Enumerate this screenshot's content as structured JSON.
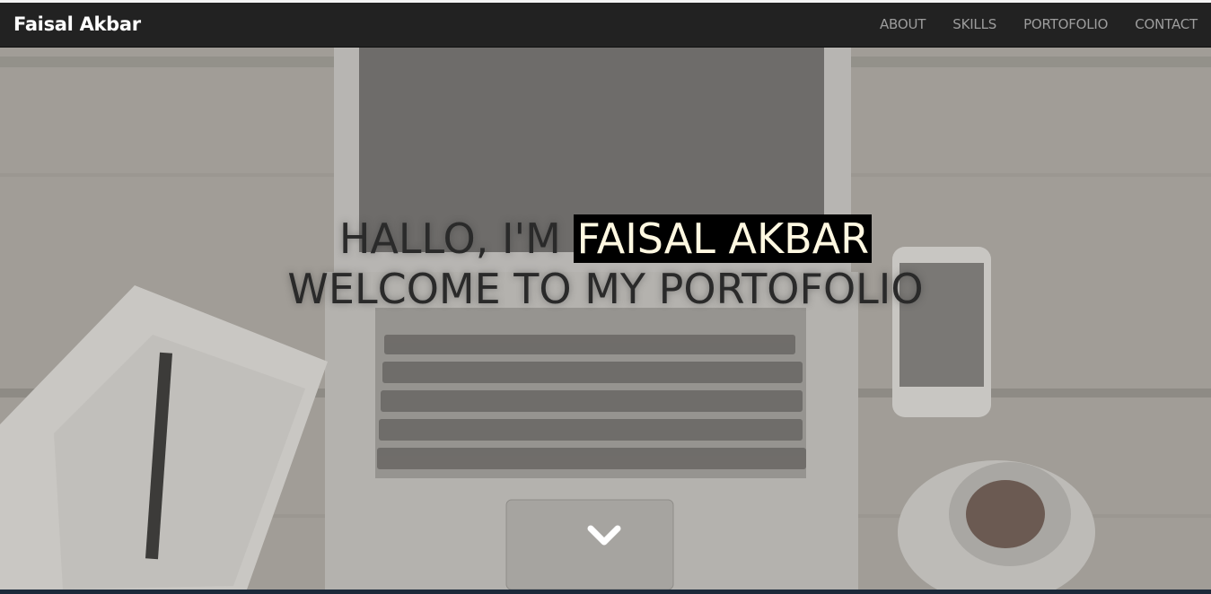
{
  "navbar": {
    "brand": "Faisal Akbar",
    "links": [
      {
        "label": "ABOUT"
      },
      {
        "label": "SKILLS"
      },
      {
        "label": "PORTOFOLIO"
      },
      {
        "label": "CONTACT"
      }
    ]
  },
  "hero": {
    "greeting_prefix": "HALLO, I'M",
    "name_highlight": "FAISAL AKBAR",
    "welcome": "WELCOME TO MY PORTOFOLIO",
    "scroll_icon": "chevron-down-icon"
  },
  "colors": {
    "navbar_bg": "#222222",
    "nav_link": "#9d9d9d",
    "highlight_bg": "#000000",
    "highlight_text": "#fff8e1"
  }
}
